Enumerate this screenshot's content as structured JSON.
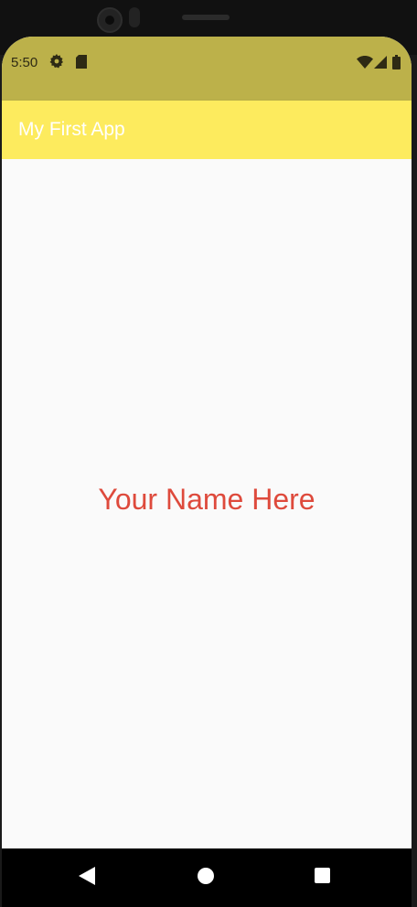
{
  "status_bar": {
    "time": "5:50",
    "icons": [
      "gear-icon",
      "sd-card-icon",
      "wifi-icon",
      "signal-icon",
      "battery-icon"
    ],
    "background": "#bcb14a"
  },
  "app_bar": {
    "title": "My First App",
    "background": "#fdeb5e",
    "title_color": "#ffffff"
  },
  "main": {
    "text": "Your Name Here",
    "text_color": "#de4a3c",
    "background": "#fafafa"
  },
  "nav_bar": {
    "buttons": [
      "back-icon",
      "home-icon",
      "recents-icon"
    ]
  }
}
